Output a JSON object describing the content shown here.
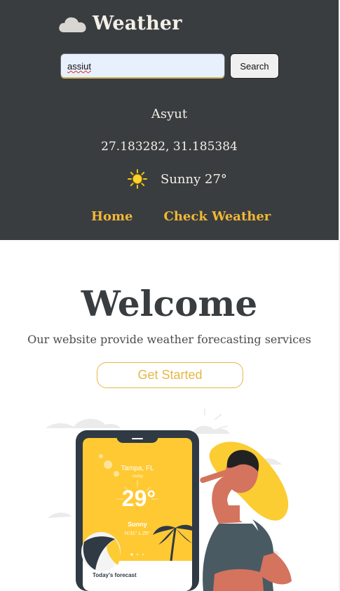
{
  "header": {
    "brand": "Weather",
    "icon": "cloud-icon",
    "search": {
      "value": "assiut",
      "button": "Search"
    },
    "location": {
      "city": "Asyut",
      "coordinates": "27.183282, 31.185384"
    },
    "condition": {
      "icon": "sun-icon",
      "text": "Sunny 27°"
    },
    "nav": [
      "Home",
      "Check Weather"
    ]
  },
  "hero": {
    "title": "Welcome",
    "subtitle": "Our website provide weather forecasting services",
    "button": "Get Started"
  },
  "illustration": {
    "city": "Tampa, FL",
    "day": "Today",
    "temperature": "29°",
    "condition": "Sunny",
    "range": "H:31° L:25°",
    "forecast": "Today's forecast"
  },
  "colors": {
    "header": "#393d40",
    "accent": "#f2b735",
    "text_light": "#f2efe6",
    "phone_screen": "#ffc933"
  }
}
